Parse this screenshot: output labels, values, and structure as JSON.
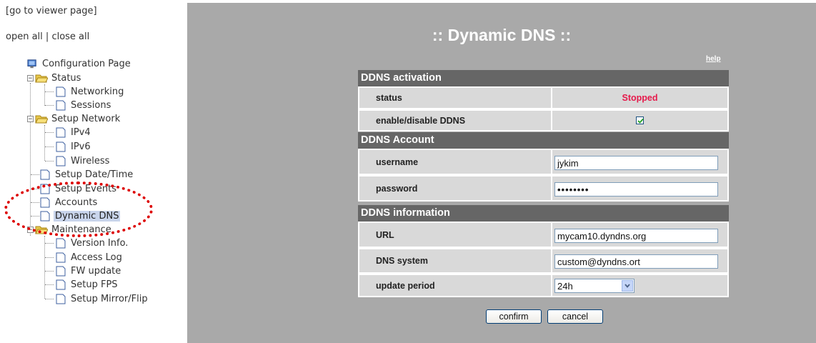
{
  "sidebar": {
    "viewer_link": "[go to viewer page]",
    "open_all": "open all",
    "separator": "|",
    "close_all": "close all",
    "root": "Configuration Page",
    "status": "Status",
    "networking": "Networking",
    "sessions": "Sessions",
    "setup_network": "Setup Network",
    "ipv4": "IPv4",
    "ipv6": "IPv6",
    "wireless": "Wireless",
    "setup_datetime": "Setup Date/Time",
    "setup_events": "Setup Events",
    "accounts": "Accounts",
    "dynamic_dns": "Dynamic DNS",
    "maintenance": "Maintenance",
    "version_info": "Version Info.",
    "access_log": "Access Log",
    "fw_update": "FW update",
    "setup_fps": "Setup FPS",
    "setup_mirror": "Setup Mirror/Flip",
    "selected_color": "#c9d5ec"
  },
  "main": {
    "title": ":: Dynamic DNS ::",
    "help": "help",
    "activation": {
      "header": "DDNS activation",
      "status_label": "status",
      "status_value": "Stopped",
      "enable_label": "enable/disable DDNS",
      "enable_checked": true
    },
    "account": {
      "header": "DDNS Account",
      "username_label": "username",
      "username_value": "jykim",
      "password_label": "password",
      "password_value": "••••••••"
    },
    "info": {
      "header": "DDNS information",
      "url_label": "URL",
      "url_value": "mycam10.dyndns.org",
      "dns_label": "DNS system",
      "dns_value": "custom@dyndns.ort",
      "period_label": "update period",
      "period_value": "24h"
    },
    "confirm": "confirm",
    "cancel": "cancel"
  },
  "colors": {
    "panel_bg": "#a9a9a9",
    "section_header": "#666666",
    "cell_bg": "#d9d9d9",
    "status_stopped": "#e6194b",
    "highlight_ring": "#dd0000"
  }
}
